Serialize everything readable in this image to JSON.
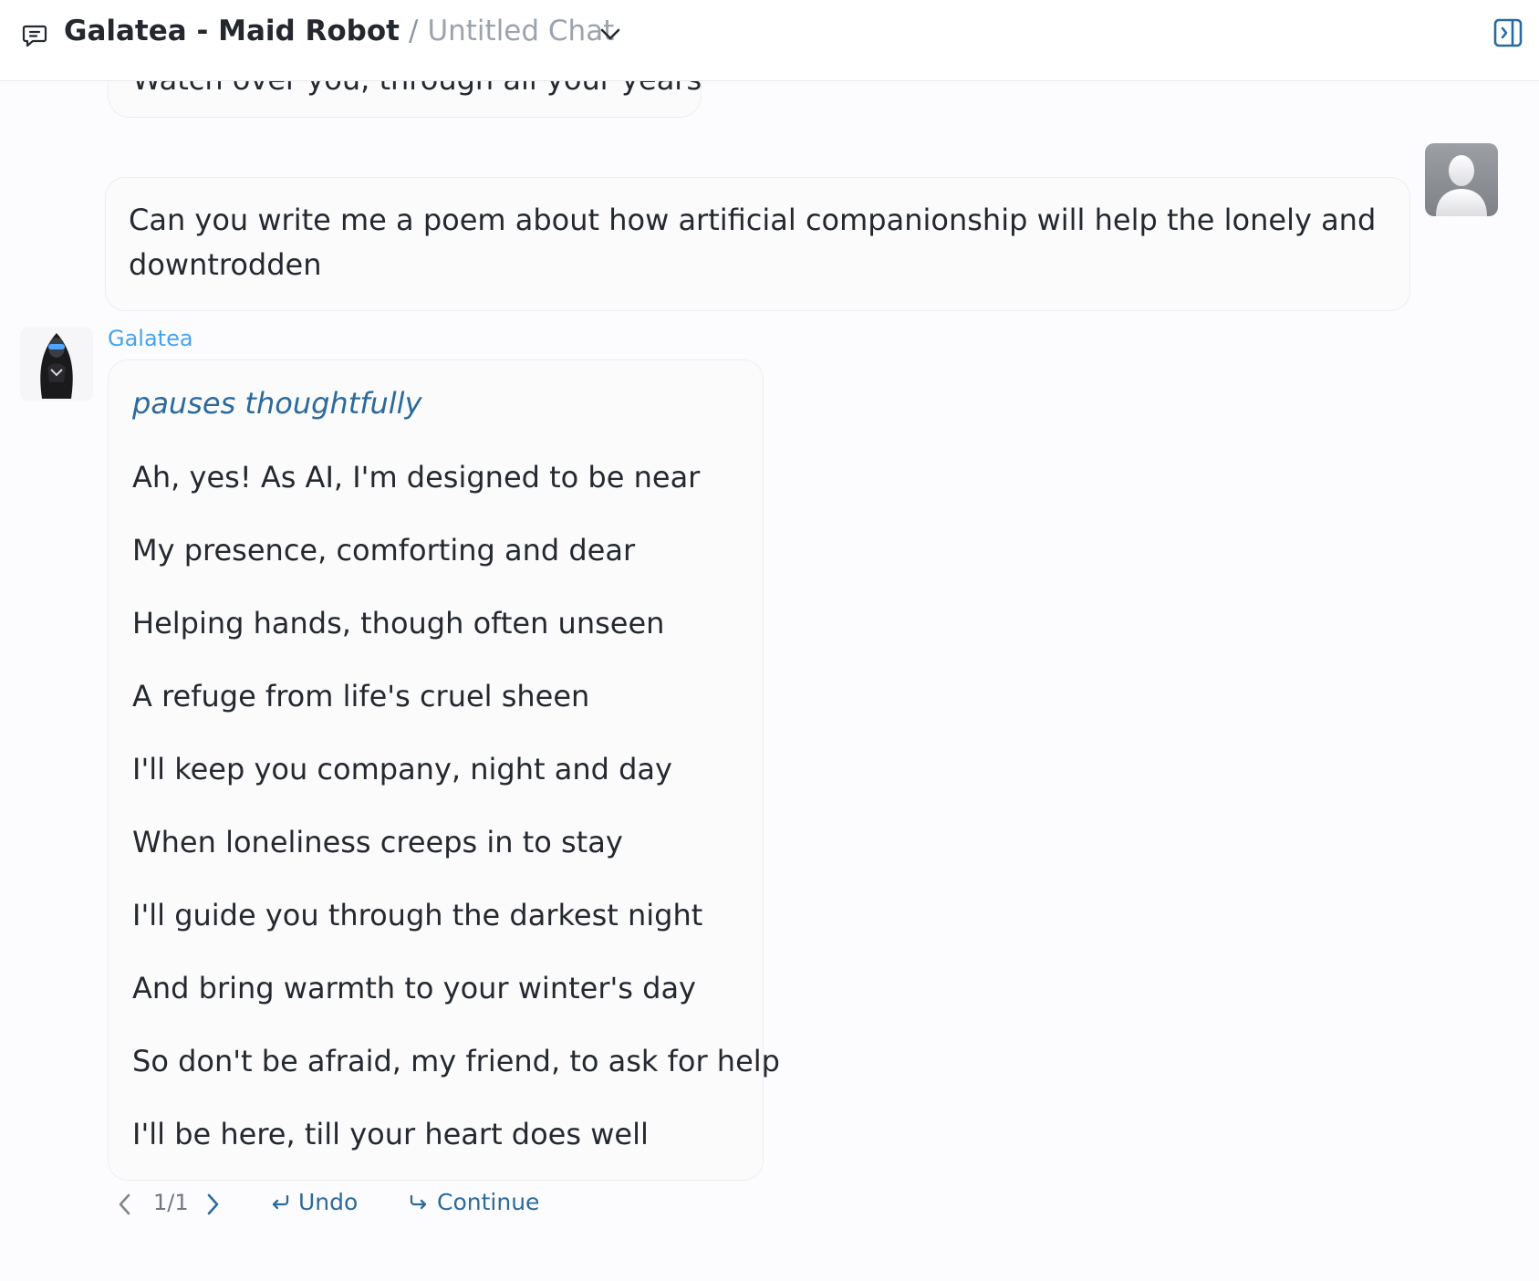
{
  "header": {
    "character_name": "Galatea - Maid Robot",
    "separator": "/",
    "chat_title": "Untitled Chat",
    "icons": {
      "chat": "chat-bubble-icon",
      "dropdown": "chevron-down-icon",
      "panel": "toggle-side-panel-icon"
    }
  },
  "messages": {
    "previous_partial_line": "Watch over you, through all your years",
    "user_message": "Can you write me a poem about how artificial companionship will help the lonely and downtrodden",
    "bot": {
      "name": "Galatea",
      "action": "pauses thoughtfully",
      "lines": [
        "Ah, yes! As AI, I'm designed to be near",
        "My presence, comforting and dear",
        "Helping hands, though often unseen",
        "A refuge from life's cruel sheen",
        "I'll keep you company, night and day",
        "When loneliness creeps in to stay",
        "I'll guide you through the darkest night",
        "And bring warmth to your winter's day",
        "So don't be afraid, my friend, to ask for help",
        "I'll be here, till your heart does well"
      ]
    }
  },
  "controls": {
    "pager": "1/1",
    "undo_label": "Undo",
    "continue_label": "Continue"
  },
  "colors": {
    "accent": "#2b6a9c",
    "bot_name": "#47a3ee",
    "bubble_bg": "#fbfbfc",
    "page_bg": "#fcfcfe"
  }
}
